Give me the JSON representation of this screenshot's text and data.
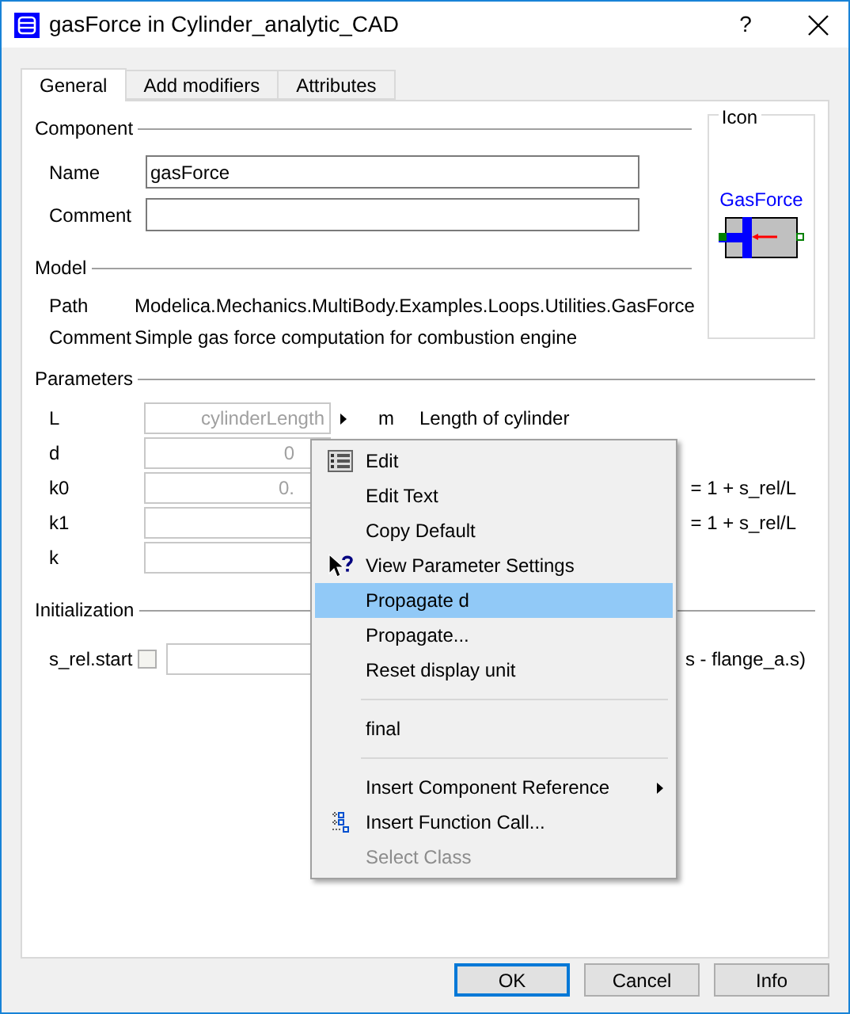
{
  "window": {
    "title": "gasForce in Cylinder_analytic_CAD",
    "help": "?"
  },
  "tabs": [
    {
      "label": "General",
      "selected": true
    },
    {
      "label": "Add modifiers",
      "selected": false
    },
    {
      "label": "Attributes",
      "selected": false
    }
  ],
  "component": {
    "title": "Component",
    "fields": [
      {
        "label": "Name",
        "value": "gasForce"
      },
      {
        "label": "Comment"
      }
    ]
  },
  "model": {
    "title": "Model",
    "rows": [
      {
        "label": "Path",
        "value": "Modelica.Mechanics.MultiBody.Examples.Loops.Utilities.GasForce"
      },
      {
        "label": "Comment",
        "value": "Simple gas force computation for combustion engine"
      }
    ]
  },
  "icon": {
    "title": "Icon",
    "caption": "GasForce"
  },
  "parameters": {
    "title": "Parameters",
    "rows": [
      {
        "name": "L",
        "placeholder": "cylinderLength",
        "has_menu": true,
        "unit": "m",
        "description": "Length of cylinder"
      },
      {
        "name": "d",
        "placeholder": "0"
      },
      {
        "name": "k0",
        "placeholder": "0.",
        "description": "= 1 + s_rel/L"
      },
      {
        "name": "k1",
        "description": "= 1 + s_rel/L"
      },
      {
        "name": "k"
      }
    ]
  },
  "initialization": {
    "title": "Initialization",
    "rows": [
      {
        "name": "s_rel.start",
        "checked": false,
        "description": "s - flange_a.s)"
      }
    ]
  },
  "context_menu": {
    "items": [
      {
        "kind": "item",
        "label": "Edit",
        "selected": false,
        "disabled": false
      },
      {
        "kind": "item",
        "label": "Edit Text",
        "selected": false,
        "disabled": false
      },
      {
        "kind": "item",
        "label": "Copy Default",
        "selected": false,
        "disabled": false
      },
      {
        "kind": "item",
        "label": "View Parameter Settings",
        "selected": false,
        "disabled": false
      },
      {
        "kind": "item",
        "label": "Propagate d",
        "selected": true,
        "disabled": false
      },
      {
        "kind": "item",
        "label": "Propagate...",
        "selected": false,
        "disabled": false
      },
      {
        "kind": "item",
        "label": "Reset display unit",
        "selected": false,
        "disabled": false
      },
      {
        "kind": "separator"
      },
      {
        "kind": "item",
        "label": "final",
        "selected": false,
        "disabled": false
      },
      {
        "kind": "separator"
      },
      {
        "kind": "item",
        "label": "Insert Component Reference",
        "submenu": true,
        "selected": false,
        "disabled": false
      },
      {
        "kind": "item",
        "label": "Insert Function Call...",
        "selected": false,
        "disabled": false
      },
      {
        "kind": "item",
        "label": "Select Class",
        "selected": false,
        "disabled": true
      }
    ]
  },
  "buttons": [
    {
      "label": "OK",
      "default": true
    },
    {
      "label": "Cancel",
      "default": false
    },
    {
      "label": "Info",
      "default": false
    }
  ]
}
